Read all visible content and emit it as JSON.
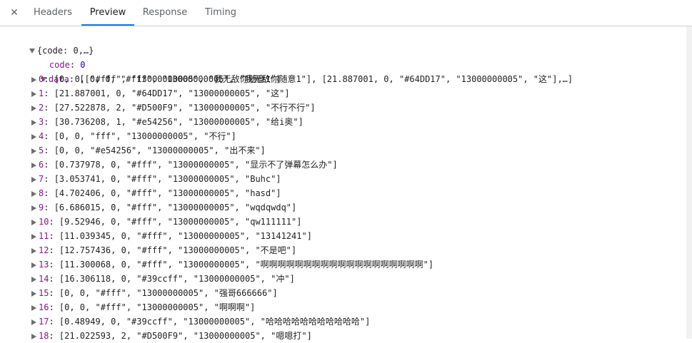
{
  "tabs": {
    "close_icon": "close-icon",
    "items": [
      {
        "label": "Headers"
      },
      {
        "label": "Preview"
      },
      {
        "label": "Response"
      },
      {
        "label": "Timing"
      }
    ],
    "active": "Preview",
    "accent_color": "#1a73e8"
  },
  "tree": {
    "root_summary": "{code: 0,…}",
    "code_key": "code",
    "code_value": "0",
    "data_key": "data",
    "data_summary": "[[0, 0, \"#fff\", \"13000000005\", \"我无敌你随意1\"], [21.887001, 0, \"#64DD17\", \"13000000005\", \"这\"],…]",
    "items": [
      {
        "index": "0",
        "value": "[0, 0, \"#fff\", \"13000000005\", \"我无敌你随意1\"]"
      },
      {
        "index": "1",
        "value": "[21.887001, 0, \"#64DD17\", \"13000000005\", \"这\"]"
      },
      {
        "index": "2",
        "value": "[27.522878, 2, \"#D500F9\", \"13000000005\", \"不行不行\"]"
      },
      {
        "index": "3",
        "value": "[30.736208, 1, \"#e54256\", \"13000000005\", \"给i奥\"]"
      },
      {
        "index": "4",
        "value": "[0, 0, \"fff\", \"13000000005\", \"不行\"]"
      },
      {
        "index": "5",
        "value": "[0, 0, \"#e54256\", \"13000000005\", \"出不来\"]"
      },
      {
        "index": "6",
        "value": "[0.737978, 0, \"#fff\", \"13000000005\", \"显示不了弹幕怎么办\"]"
      },
      {
        "index": "7",
        "value": "[3.053741, 0, \"#fff\", \"13000000005\", \"Buhc\"]"
      },
      {
        "index": "8",
        "value": "[4.702406, 0, \"#fff\", \"13000000005\", \"hasd\"]"
      },
      {
        "index": "9",
        "value": "[6.686015, 0, \"#fff\", \"13000000005\", \"wqdqwdq\"]"
      },
      {
        "index": "10",
        "value": "[9.52946, 0, \"#fff\", \"13000000005\", \"qw111111\"]"
      },
      {
        "index": "11",
        "value": "[11.039345, 0, \"#fff\", \"13000000005\", \"13141241\"]"
      },
      {
        "index": "12",
        "value": "[12.757436, 0, \"#fff\", \"13000000005\", \"不是吧\"]"
      },
      {
        "index": "13",
        "value": "[11.300068, 0, \"#fff\", \"13000000005\", \"啊啊啊啊啊啊啊啊啊啊啊啊啊啊啊啊啊啊啊\"]"
      },
      {
        "index": "14",
        "value": "[16.306118, 0, \"#39ccff\", \"13000000005\", \"冲\"]"
      },
      {
        "index": "15",
        "value": "[0, 0, \"#fff\", \"13000000005\", \"强哥666666\"]"
      },
      {
        "index": "16",
        "value": "[0, 0, \"#fff\", \"13000000005\", \"啊啊啊\"]"
      },
      {
        "index": "17",
        "value": "[0.48949, 0, \"#39ccff\", \"13000000005\", \"哈哈哈哈哈哈哈哈哈哈哈\"]"
      },
      {
        "index": "18",
        "value": "[21.022593, 2, \"#D500F9\", \"13000000005\", \"嗯嗯打\"]"
      }
    ]
  }
}
